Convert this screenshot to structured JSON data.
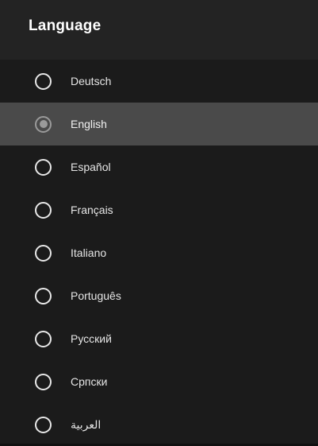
{
  "header": {
    "title": "Language"
  },
  "languages": [
    {
      "label": "Deutsch",
      "selected": false
    },
    {
      "label": "English",
      "selected": true
    },
    {
      "label": "Español",
      "selected": false
    },
    {
      "label": "Français",
      "selected": false
    },
    {
      "label": "Italiano",
      "selected": false
    },
    {
      "label": "Português",
      "selected": false
    },
    {
      "label": "Русский",
      "selected": false
    },
    {
      "label": "Српски",
      "selected": false
    },
    {
      "label": "العربية",
      "selected": false
    }
  ],
  "colors": {
    "background": "#1b1b1b",
    "header_background": "#232323",
    "selected_row": "#4a4a4a",
    "radio_on": "#9a9a9a",
    "radio_off": "#e8e8e8"
  }
}
